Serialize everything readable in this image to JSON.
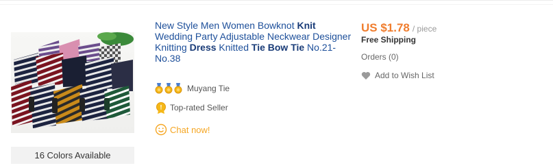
{
  "product": {
    "title_parts": [
      {
        "text": "New Style Men Women Bowknot ",
        "bold": false
      },
      {
        "text": "Knit",
        "bold": true
      },
      {
        "text": " Wedding Party Adjustable Neckwear Designer Knitting ",
        "bold": false
      },
      {
        "text": "Dress",
        "bold": true
      },
      {
        "text": " Knitted ",
        "bold": false
      },
      {
        "text": "Tie Bow Tie",
        "bold": true
      },
      {
        "text": " No.21-No.38",
        "bold": false
      }
    ],
    "colors_available": "16 Colors Available"
  },
  "seller": {
    "name": "Muyang Tie",
    "badge": "Top-rated Seller",
    "chat_label": "Chat now!",
    "medal_icon": "gold-medal-icon",
    "medal_count": 3
  },
  "pricing": {
    "price": "US $1.78",
    "unit": "/ piece",
    "shipping": "Free Shipping",
    "orders": "Orders (0)",
    "wishlist_label": "Add to Wish List"
  },
  "colors": {
    "title": "#1d4f9a",
    "title_bold": "#1a3c78",
    "price": "#f07d2e",
    "chat": "#f5a623"
  }
}
